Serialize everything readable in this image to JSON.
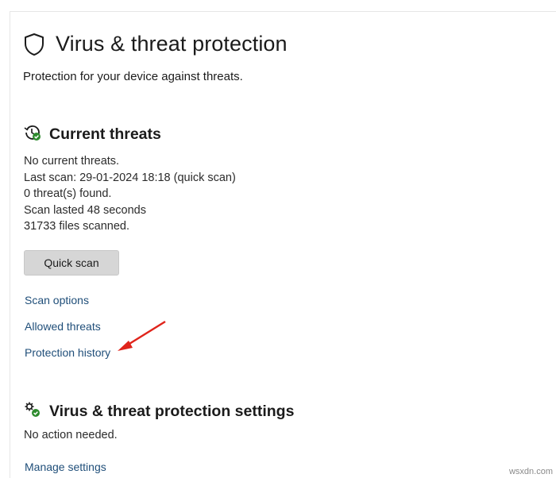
{
  "header": {
    "title": "Virus & threat protection",
    "subtitle": "Protection for your device against threats."
  },
  "current_threats": {
    "title": "Current threats",
    "lines": [
      "No current threats.",
      "Last scan: 29-01-2024 18:18 (quick scan)",
      "0 threat(s) found.",
      "Scan lasted 48 seconds",
      "31733 files scanned."
    ],
    "quick_scan_label": "Quick scan",
    "links": {
      "scan_options": "Scan options",
      "allowed_threats": "Allowed threats",
      "protection_history": "Protection history"
    }
  },
  "settings": {
    "title": "Virus & threat protection settings",
    "status": "No action needed.",
    "manage_link": "Manage settings"
  },
  "watermark": "wsxdn.com",
  "icons": {
    "header": "shield-icon",
    "current_threats": "history-clock-icon",
    "settings": "gear-settings-icon",
    "annotation": "red-arrow"
  },
  "colors": {
    "link": "#1f4e79",
    "button_bg": "#d6d6d6",
    "status_green": "#2e8b2e",
    "annotation_red": "#e0241b"
  }
}
